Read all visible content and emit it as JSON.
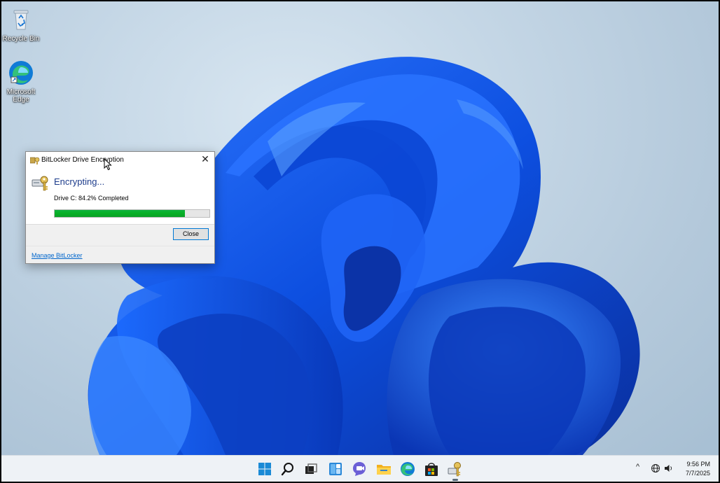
{
  "desktop": {
    "icons": [
      {
        "label": "Recycle Bin",
        "icon": "recycle-bin-icon"
      },
      {
        "label": "Microsoft Edge",
        "icon": "edge-icon"
      }
    ]
  },
  "dialog": {
    "title": "BitLocker Drive Encryption",
    "heading": "Encrypting...",
    "status": "Drive C: 84.2% Completed",
    "progress_percent": 84.2,
    "close_button": "Close",
    "manage_link": "Manage BitLocker",
    "title_close_glyph": "✕"
  },
  "taskbar": {
    "icons": [
      "windows-start-icon",
      "search-icon",
      "task-view-icon",
      "widgets-icon",
      "chat-icon",
      "file-explorer-icon",
      "edge-icon",
      "store-icon",
      "bitlocker-icon"
    ],
    "tray": {
      "chevron": "^",
      "time": "9:56 PM",
      "date": "7/7/2025"
    }
  },
  "colors": {
    "accent": "#0078d4",
    "progress": "#06b025",
    "heading": "#1e3d8c",
    "link": "#0066cc"
  }
}
